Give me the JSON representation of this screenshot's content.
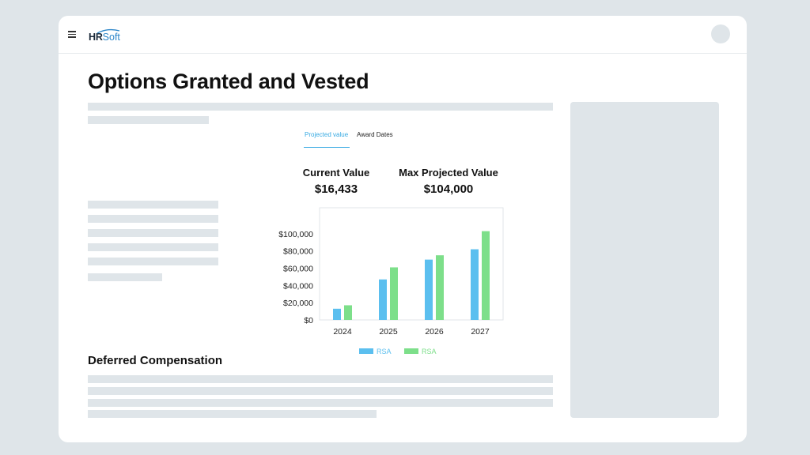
{
  "header": {
    "logo_hr": "HR",
    "logo_soft": "Soft"
  },
  "page": {
    "title": "Options Granted and Vested",
    "section_title": "Deferred Compensation"
  },
  "tabs": [
    {
      "label": "Projected value",
      "active": true
    },
    {
      "label": "Award Dates",
      "active": false
    }
  ],
  "metrics": {
    "current_label": "Current Value",
    "current_value": "$16,433",
    "max_label": "Max Projected Value",
    "max_value": "$104,000"
  },
  "colors": {
    "accent": "#35a9e2",
    "series_blue": "#5bbfef",
    "series_green": "#7ddf8a",
    "placeholder": "#dfe5e9"
  },
  "chart_data": {
    "type": "bar",
    "categories": [
      "2024",
      "2025",
      "2026",
      "2027"
    ],
    "series": [
      {
        "name": "RSA",
        "color": "#5bbfef",
        "values": [
          13000,
          47000,
          70000,
          82000
        ]
      },
      {
        "name": "RSA",
        "color": "#7ddf8a",
        "values": [
          17000,
          61000,
          75000,
          103000
        ]
      }
    ],
    "ylim": [
      0,
      110000
    ],
    "yticks": [
      "$0",
      "$20,000",
      "$40,000",
      "$60,000",
      "$80,000",
      "$100,000"
    ],
    "ytick_values": [
      0,
      20000,
      40000,
      60000,
      80000,
      100000
    ],
    "grid": false,
    "legend": "bottom"
  }
}
